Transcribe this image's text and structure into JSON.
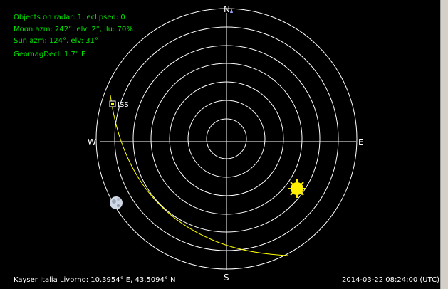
{
  "info": {
    "objects_line": "Objects on radar: 1, eclipsed: 0",
    "moon_line": "Moon azm: 242°, elv: 2°, ilu: 70%",
    "sun_line": "Sun azm: 124°, elv: 31°",
    "geomag_line": "GeomagDecl: 1.7° E"
  },
  "compass": {
    "north": "N",
    "south": "S",
    "east": "E",
    "west": "W"
  },
  "satellite": {
    "label": "ISS"
  },
  "footer": {
    "location": "Kayser Italia Livorno: 10.3954° E, 43.5094° N",
    "datetime": "2014-03-22 08:24:00 (UTC)"
  },
  "colors": {
    "background": "#000000",
    "rings": "#ffffff",
    "info_text": "#00e400",
    "track": "#ffff00",
    "sun": "#ffee00"
  },
  "icons": {
    "sun": "sun-icon",
    "moon": "moon-icon",
    "satellite": "satellite-marker-icon",
    "north": "north-arrow-icon"
  }
}
